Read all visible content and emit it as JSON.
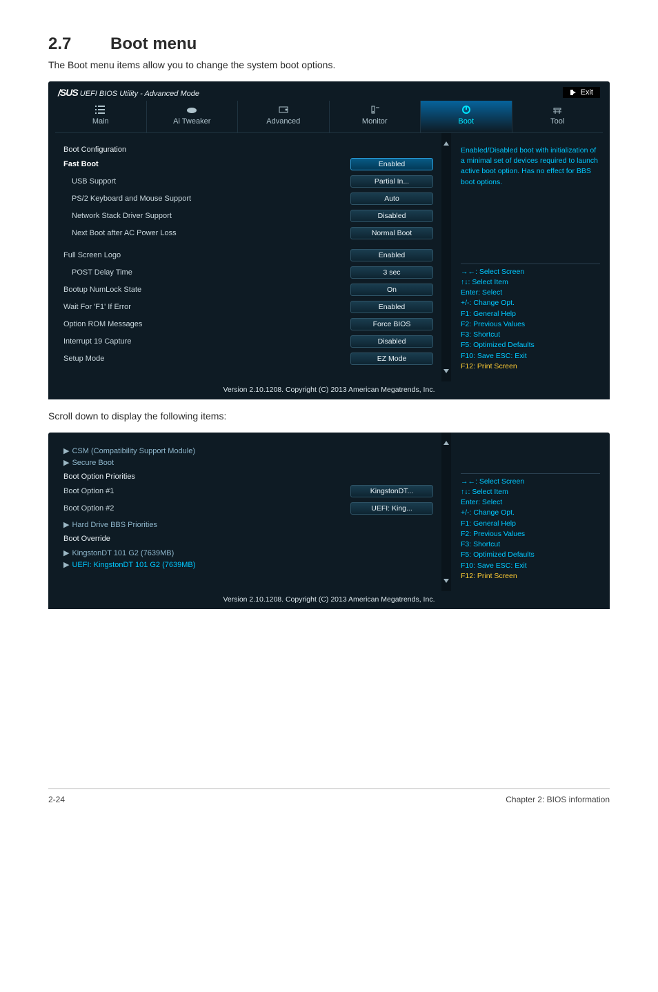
{
  "doc": {
    "section_number": "2.7",
    "section_title": "Boot menu",
    "intro": "The Boot menu items allow you to change the system boot options.",
    "scroll_caption": "Scroll down to display the following items:",
    "footer_left": "2-24",
    "footer_right": "Chapter 2: BIOS information"
  },
  "bios": {
    "brand_prefix": "/SUS",
    "title": "UEFI BIOS Utility - Advanced Mode",
    "exit_label": "Exit",
    "tabs": [
      "Main",
      "Ai Tweaker",
      "Advanced",
      "Monitor",
      "Boot",
      "Tool"
    ],
    "active_tab": "Boot",
    "group1_title": "Boot Configuration",
    "settings1": {
      "fast_boot": {
        "label": "Fast Boot",
        "value": "Enabled"
      },
      "usb_support": {
        "label": "USB Support",
        "value": "Partial In..."
      },
      "ps2": {
        "label": "PS/2 Keyboard and Mouse Support",
        "value": "Auto"
      },
      "net_stack": {
        "label": "Network Stack Driver Support",
        "value": "Disabled"
      },
      "next_boot": {
        "label": "Next Boot after AC Power Loss",
        "value": "Normal Boot"
      }
    },
    "settings2": {
      "full_screen_logo": {
        "label": "Full Screen Logo",
        "value": "Enabled"
      },
      "post_delay": {
        "label": "POST Delay Time",
        "value": "3 sec"
      },
      "numlock": {
        "label": "Bootup NumLock State",
        "value": "On"
      },
      "wait_f1": {
        "label": "Wait For 'F1' If Error",
        "value": "Enabled"
      },
      "option_rom": {
        "label": "Option ROM Messages",
        "value": "Force BIOS"
      },
      "int19": {
        "label": "Interrupt 19 Capture",
        "value": "Disabled"
      },
      "setup_mode": {
        "label": "Setup Mode",
        "value": "EZ Mode"
      }
    },
    "help_text": "Enabled/Disabled boot with initialization of a minimal set of devices required to launch active boot option. Has no effect for BBS boot options.",
    "help_keys": {
      "l1": "→←: Select Screen",
      "l2": "↑↓: Select Item",
      "l3": "Enter: Select",
      "l4": "+/-: Change Opt.",
      "l5": "F1: General Help",
      "l6": "F2: Previous Values",
      "l7": "F3: Shortcut",
      "l8": "F5: Optimized Defaults",
      "l9": "F10: Save  ESC: Exit",
      "l10": "F12: Print Screen"
    },
    "footer": "Version 2.10.1208. Copyright (C) 2013 American Megatrends, Inc."
  },
  "bios2": {
    "csm": "CSM (Compatibility Support Module)",
    "secure_boot": "Secure Boot",
    "priorities_title": "Boot Option Priorities",
    "boot_opt1": {
      "label": "Boot Option #1",
      "value": "KingstonDT..."
    },
    "boot_opt2": {
      "label": "Boot Option #2",
      "value": "UEFI: King..."
    },
    "hdd_bbs": "Hard Drive BBS Priorities",
    "override_title": "Boot Override",
    "override1": "KingstonDT 101 G2  (7639MB)",
    "override2": "UEFI: KingstonDT 101 G2 (7639MB)"
  }
}
